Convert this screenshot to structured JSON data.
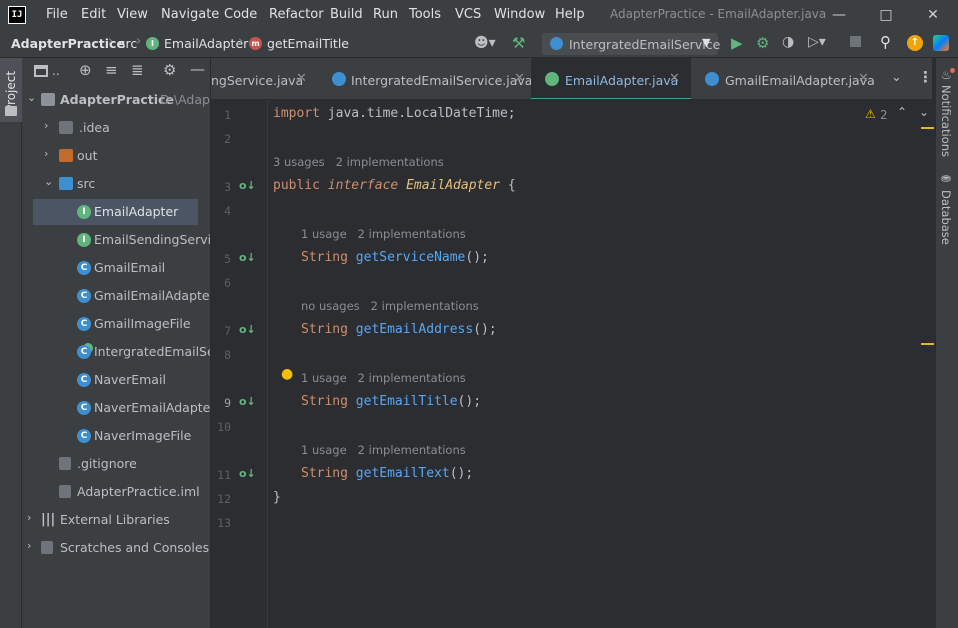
{
  "app": {
    "logo": "IJ",
    "window_title": "AdapterPractice - EmailAdapter.java",
    "menu": [
      "File",
      "Edit",
      "View",
      "Navigate",
      "Code",
      "Refactor",
      "Build",
      "Run",
      "Tools",
      "VCS",
      "Window",
      "Help"
    ]
  },
  "breadcrumb": {
    "project": "AdapterPractice",
    "folder": "src",
    "class": "EmailAdapter",
    "method": "getEmailTitle"
  },
  "run_config": {
    "label": "IntergratedEmailService"
  },
  "project_panel": {
    "tab_label": "Project",
    "root": {
      "name": "AdapterPractice",
      "path": "D:\\Adap"
    },
    "items": [
      {
        "label": ".idea",
        "kind": "folder"
      },
      {
        "label": "out",
        "kind": "folder-orange"
      },
      {
        "label": "src",
        "kind": "folder-src"
      },
      {
        "label": "EmailAdapter",
        "kind": "interface"
      },
      {
        "label": "EmailSendingService",
        "kind": "interface"
      },
      {
        "label": "GmailEmail",
        "kind": "class"
      },
      {
        "label": "GmailEmailAdapter",
        "kind": "class"
      },
      {
        "label": "GmailImageFile",
        "kind": "class"
      },
      {
        "label": "IntergratedEmailService",
        "kind": "class-main"
      },
      {
        "label": "NaverEmail",
        "kind": "class"
      },
      {
        "label": "NaverEmailAdapter",
        "kind": "class"
      },
      {
        "label": "NaverImageFile",
        "kind": "class"
      },
      {
        "label": ".gitignore",
        "kind": "file"
      },
      {
        "label": "AdapterPractice.iml",
        "kind": "file"
      },
      {
        "label": "External Libraries",
        "kind": "libs"
      },
      {
        "label": "Scratches and Consoles",
        "kind": "scratches"
      }
    ]
  },
  "tabs": [
    {
      "label": "ngService.java",
      "icon": "interface"
    },
    {
      "label": "IntergratedEmailService.java",
      "icon": "class"
    },
    {
      "label": "EmailAdapter.java",
      "icon": "interface"
    },
    {
      "label": "GmailEmailAdapter.java",
      "icon": "class"
    }
  ],
  "editor": {
    "warning_count": "2",
    "line_numbers": [
      "1",
      "2",
      "3",
      "4",
      "5",
      "6",
      "7",
      "8",
      "9",
      "10",
      "11",
      "12",
      "13"
    ],
    "line1": {
      "kw": "import",
      "rest": " java.time.LocalDateTime;"
    },
    "hint_iface": {
      "usages": "3 usages",
      "impls": "2 implementations"
    },
    "line3": {
      "public": "public",
      "interface": "interface",
      "name": "EmailAdapter",
      "brace": " {"
    },
    "hint5": {
      "usages": "1 usage",
      "impls": "2 implementations"
    },
    "line5": {
      "type": "String",
      "method": "getServiceName",
      "rest": "();"
    },
    "hint7": {
      "usages": "no usages",
      "impls": "2 implementations"
    },
    "line7": {
      "type": "String",
      "method": "getEmailAddress",
      "rest": "();"
    },
    "hint9": {
      "usages": "1 usage",
      "impls": "2 implementations"
    },
    "line9": {
      "type": "String",
      "method": "getEmailTitle",
      "rest": "();"
    },
    "hint11": {
      "usages": "1 usage",
      "impls": "2 implementations"
    },
    "line11": {
      "type": "String",
      "method": "getEmailText",
      "rest": "();"
    },
    "line12": "}"
  },
  "right_strip": {
    "notifications": "Notifications",
    "database": "Database"
  },
  "colors": {
    "accent": "#4e9c97",
    "keyword": "#cf8e6d",
    "method": "#56a8f5",
    "hint": "#8a8d93",
    "interface_icon": "#5fb57d",
    "class_icon": "#3d8fd1"
  }
}
